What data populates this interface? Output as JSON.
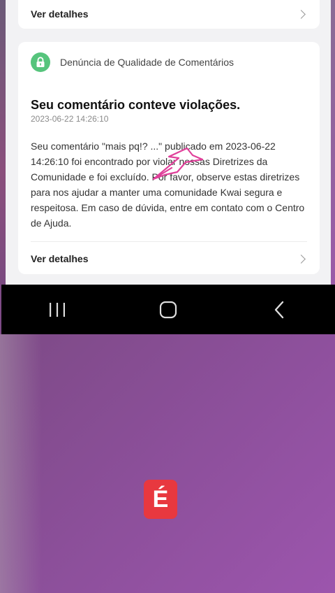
{
  "top_card": {
    "details_label": "Ver detalhes"
  },
  "notification": {
    "category": "Denúncia de Qualidade de Comentários",
    "title": "Seu comentário conteve violações.",
    "timestamp": "2023-06-22 14:26:10",
    "body": "Seu comentário \"mais pq!? ...\" publicado em 2023-06-22 14:26:10 foi encontrado por violar nossas Diretrizes da Comunidade e foi excluído. Por favor, observe estas diretrizes para nos ajudar a manter uma comunidade Kwai segura e respeitosa. Em caso de dúvida, entre em contato com o Centro de Ajuda.",
    "details_label": "Ver detalhes"
  },
  "nav": {
    "recents_icon": "recent-apps-icon",
    "home_icon": "home-icon",
    "back_icon": "back-icon"
  },
  "logo": {
    "letter": "É"
  },
  "colors": {
    "badge_green": "#56c47c",
    "annotation_pink": "#e0409a",
    "logo_red": "#e8383f"
  }
}
